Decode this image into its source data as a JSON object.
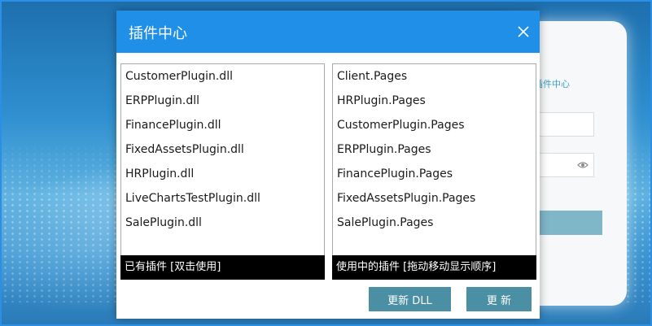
{
  "dialog": {
    "title": "插件中心",
    "close_icon": "close-icon"
  },
  "installed_plugins": {
    "items": [
      "CustomerPlugin.dll",
      "ERPPlugin.dll",
      "FinancePlugin.dll",
      "FixedAssetsPlugin.dll",
      "HRPlugin.dll",
      "LiveChartsTestPlugin.dll",
      "SalePlugin.dll"
    ],
    "footer": "已有插件 [双击使用]"
  },
  "active_plugins": {
    "items": [
      "Client.Pages",
      "HRPlugin.Pages",
      "CustomerPlugin.Pages",
      "ERPPlugin.Pages",
      "FinancePlugin.Pages",
      "FixedAssetsPlugin.Pages",
      "SalePlugin.Pages"
    ],
    "footer": "使用中的插件 [拖动移动显示顺序]"
  },
  "buttons": {
    "update_dll": "更新 DLL",
    "update": "更 新"
  },
  "background_login": {
    "plugin_center_link": "插件中心",
    "password_toggle_icon": "eye-icon"
  },
  "colors": {
    "header": "#1f8fe8",
    "button": "#4a8fa3",
    "panel_footer": "#000000"
  }
}
